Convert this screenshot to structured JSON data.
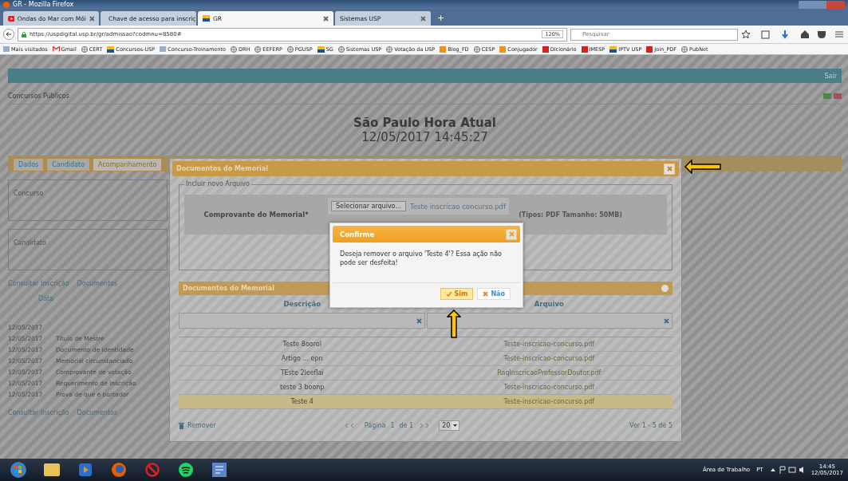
{
  "window": {
    "title": "GR - Mozilla Firefox"
  },
  "tabs": [
    {
      "label": "Ondas do Mar com Mói",
      "selected": false,
      "kind": "video"
    },
    {
      "label": "Chave de acesso para inscriç",
      "selected": false,
      "kind": "mail"
    },
    {
      "label": "GR",
      "selected": true,
      "kind": "usp"
    },
    {
      "label": "Sistemas USP",
      "selected": false,
      "kind": "none"
    }
  ],
  "new_tab": "+",
  "address": {
    "url": "https://uspdigital.usp.br/gr/admissao?codmnu=8580#",
    "zoom": "120%",
    "search_placeholder": "Pesquisar"
  },
  "bookmarks": [
    {
      "label": "Mais visitados",
      "kind": "folder"
    },
    {
      "label": "Gmail",
      "kind": "mail"
    },
    {
      "label": "CERT",
      "kind": "globe"
    },
    {
      "label": "Concursos-USP",
      "kind": "usp"
    },
    {
      "label": "Concurso-Treinamento",
      "kind": "folder"
    },
    {
      "label": "DRH",
      "kind": "globe"
    },
    {
      "label": "EEFERP",
      "kind": "globe"
    },
    {
      "label": "PGUSP",
      "kind": "globe"
    },
    {
      "label": "SG",
      "kind": "usp"
    },
    {
      "label": "Sistemas USP",
      "kind": "globe"
    },
    {
      "label": "Votação da USP",
      "kind": "globe"
    },
    {
      "label": "Blog_FD",
      "kind": "orange"
    },
    {
      "label": "CESP",
      "kind": "globe"
    },
    {
      "label": "Conjugador",
      "kind": "orange"
    },
    {
      "label": "Dicionário",
      "kind": "red"
    },
    {
      "label": "IMESP",
      "kind": "red"
    },
    {
      "label": "IPTV USP",
      "kind": "usp"
    },
    {
      "label": "Join_PDF",
      "kind": "red"
    },
    {
      "label": "PubNet",
      "kind": "globe"
    }
  ],
  "page": {
    "header_link": "Sair",
    "breadcrumb": "Concursos Públicos",
    "clock_title": "São Paulo Hora Atual",
    "clock_time": "12/05/2017 14:45:27",
    "tabs": [
      {
        "label": "Dados",
        "selected": false
      },
      {
        "label": "Candidato",
        "selected": false
      },
      {
        "label": "Acompanhamento",
        "selected": true
      }
    ],
    "fieldsets": [
      "Concurso",
      "Candidato"
    ],
    "links": [
      "Consultar Inscrição",
      "Documentos"
    ],
    "date_header": "Data",
    "documents": [
      {
        "date": "12/05/2017"
      },
      {
        "date": "12/05/2017",
        "title": "Título de Mestre"
      },
      {
        "date": "12/05/2017",
        "title": "Documento de identidade"
      },
      {
        "date": "12/05/2017",
        "title": "Memorial circunstanciado"
      },
      {
        "date": "12/05/2017",
        "title": "Comprovante de votação"
      },
      {
        "date": "12/05/2017",
        "title": "Requerimento de inscrição"
      },
      {
        "date": "12/05/2017",
        "title": "Prova de que é portador"
      }
    ],
    "bottom_links": [
      "Consultar Inscrição",
      "Documentos"
    ]
  },
  "modal": {
    "title": "Documentos do Memorial",
    "upload_legend": "Incluir novo Arquivo",
    "upload_label": "Comprovante do Memorial*",
    "choose_button": "Selecionar arquivo...",
    "chosen_file": "Teste inscricao concurso.pdf",
    "types_note": "(Tipos: PDF Tamanho: 50MB)",
    "list_title": "Documentos do Memorial",
    "columns": [
      "Descrição",
      "Arquivo"
    ],
    "rows": [
      {
        "description": "Teste 8oorol",
        "file": "Teste-inscricao-concurso.pdf",
        "selected": false
      },
      {
        "description": "Artigo ... epn",
        "file": "Teste-inscricao-concurso.pdf",
        "selected": false
      },
      {
        "description": "TEste 2leeflai",
        "file": "RaqInscricaoProfessorDoutor.pdf",
        "selected": false
      },
      {
        "description": "teste 3 boonp",
        "file": "Teste-inscricao-concurso.pdf",
        "selected": false
      },
      {
        "description": "Teste 4",
        "file": "Teste-inscricao-concurso.pdf",
        "selected": true
      }
    ],
    "remove": "Remover",
    "pager": {
      "page_label": "Página",
      "page": "1",
      "of": "de 1",
      "page_size": "20",
      "summary": "Ver 1 - 5 de 5"
    }
  },
  "confirm": {
    "title": "Confirme",
    "message": "Deseja remover o arquivo 'Teste 4'? Essa ação não pode ser desfeita!",
    "buttons": [
      {
        "label": "Sim",
        "kind": "yes",
        "focused": true
      },
      {
        "label": "Não",
        "kind": "no",
        "focused": false
      }
    ]
  },
  "annotations": [
    {
      "kind": "left"
    },
    {
      "kind": "up"
    }
  ],
  "taskbar": {
    "apps": [
      {
        "kind": "start"
      },
      {
        "kind": "folder"
      },
      {
        "kind": "media"
      },
      {
        "kind": "firefox"
      },
      {
        "kind": "blocked"
      },
      {
        "kind": "spotify"
      },
      {
        "kind": "document"
      }
    ],
    "desktop": "Área de Trabalho",
    "lang": "PT",
    "time": "14:45",
    "date": "12/05/2017"
  }
}
